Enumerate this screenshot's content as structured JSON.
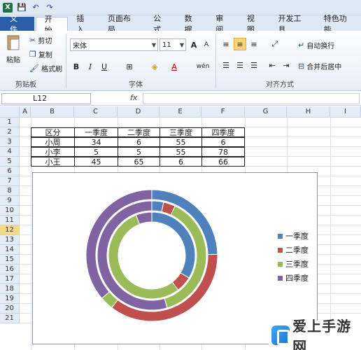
{
  "qat": {
    "app_icon": "X",
    "undo": "↶",
    "redo": "↷",
    "save": "💾"
  },
  "tabs": [
    "文件",
    "开始",
    "插入",
    "页面布局",
    "公式",
    "数据",
    "审阅",
    "视图",
    "开发工具",
    "特色功能"
  ],
  "ribbon": {
    "paste": "粘贴",
    "cut": "剪切",
    "copy": "复制",
    "format_painter": "格式刷",
    "clipboard_group": "剪贴板",
    "font_name": "宋体",
    "font_size": "11",
    "font_group": "字体",
    "bold": "B",
    "italic": "I",
    "underline": "U",
    "font_color": "A",
    "grow_font": "A",
    "shrink_font": "A",
    "phonetic": "wén",
    "wrap_text": "自动换行",
    "merge_center": "合并后居中",
    "align_group": "对齐方式"
  },
  "formula_bar": {
    "name_box": "L12",
    "fx": "fx",
    "value": ""
  },
  "columns": [
    "A",
    "B",
    "C",
    "D",
    "E",
    "F",
    "G",
    "H",
    "I"
  ],
  "rows": [
    "1",
    "2",
    "3",
    "4",
    "5",
    "6",
    "7",
    "8",
    "9",
    "10",
    "11",
    "12",
    "13",
    "14",
    "15",
    "16",
    "17",
    "18",
    "19",
    "20",
    "21"
  ],
  "selected_row": "12",
  "table": {
    "header": [
      "区分",
      "一季度",
      "二季度",
      "三季度",
      "四季度"
    ],
    "rows": [
      [
        "小周",
        "34",
        "6",
        "55",
        "6"
      ],
      [
        "小李",
        "5",
        "5",
        "55",
        "78"
      ],
      [
        "小王",
        "45",
        "65",
        "6",
        "66"
      ]
    ]
  },
  "chart_data": {
    "type": "doughnut",
    "categories": [
      "一季度",
      "二季度",
      "三季度",
      "四季度"
    ],
    "series": [
      {
        "name": "小周",
        "values": [
          34,
          6,
          55,
          6
        ]
      },
      {
        "name": "小李",
        "values": [
          5,
          5,
          55,
          78
        ]
      },
      {
        "name": "小王",
        "values": [
          45,
          65,
          6,
          66
        ]
      }
    ],
    "colors": [
      "#4f81bd",
      "#c0504d",
      "#9bbb59",
      "#8064a2"
    ],
    "legend": "right"
  },
  "watermark": "爱上手游网"
}
